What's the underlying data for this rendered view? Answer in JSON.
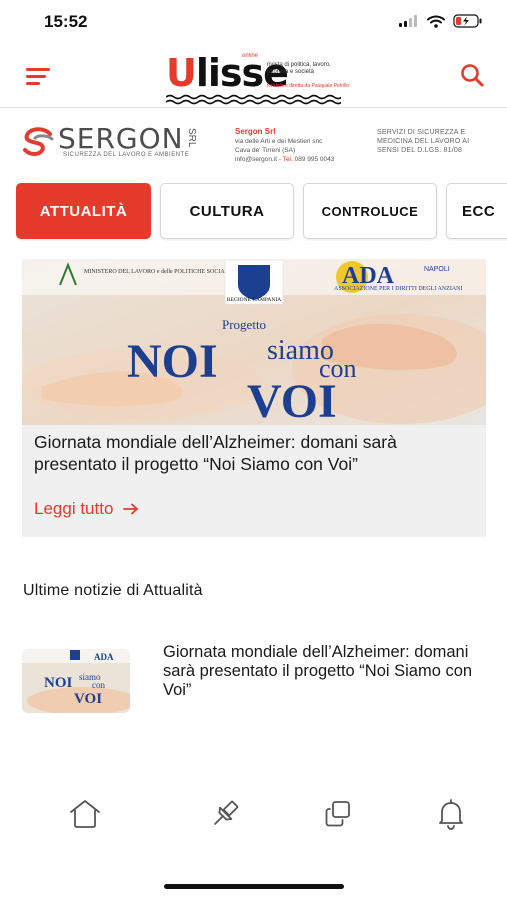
{
  "status_bar": {
    "time": "15:52"
  },
  "logo": {
    "word_first": "U",
    "word_rest": "lisse",
    "online": "online",
    "tagline": "rivista di politica, lavoro, impresa e società",
    "founder": "fondata e diretta da Pasquale Petrillo"
  },
  "sponsor": {
    "name": "SERGON",
    "srl": "SRL",
    "subtitle": "SICUREZZA DEL LAVORO E AMBIENTE",
    "company": "Sergon Srl",
    "address_line1": "via delle Arti e dei Mestieri snc",
    "address_line2": "Cava de' Tirreni (SA)",
    "email": "info@sergon.it",
    "tel_label": "Tel.",
    "tel": "089 995 0043",
    "services": "SERVIZI DI SICUREZZA E MEDICINA DEL LAVORO AI SENSI DEL D.LGS. 81/08"
  },
  "tabs": [
    {
      "label": "ATTUALITÀ",
      "active": true
    },
    {
      "label": "CULTURA",
      "active": false
    },
    {
      "label": "CONTROLUCE",
      "active": false
    },
    {
      "label": "ECC",
      "active": false
    }
  ],
  "featured": {
    "image": {
      "ministry": "MINISTERO DEL LAVORO e delle POLITICHE SOCIALI",
      "region": "REGIONE CAMPANIA",
      "ada": "ADA",
      "ada_city": "NAPOLI",
      "ada_sub": "ASSOCIAZIONE PER I DIRITTI DEGLI ANZIANI",
      "progetto": "Progetto",
      "noi": "NOI",
      "siamo": "siamo",
      "con": "con",
      "voi": "VOI"
    },
    "title": "Giornata mondiale dell’Alzheimer: domani sarà presentato il progetto “Noi Siamo con Voi”",
    "read_more": "Leggi tutto"
  },
  "section_title": "Ultime notizie di Attualità",
  "news": [
    {
      "title": "Giornata mondiale dell’Alzheimer: domani sarà presentato il progetto “Noi Siamo con Voi”",
      "thumb": {
        "noi": "NOI",
        "siamo": "siamo",
        "con": "con",
        "voi": "VOI",
        "ada": "ADA"
      }
    }
  ],
  "colors": {
    "accent": "#e53a2c",
    "text": "#1a1a1a",
    "card_bg": "#f0f0f0",
    "project_blue": "#1d3f8f"
  },
  "nav_icons": [
    "home-icon",
    "pin-icon",
    "copy-icon",
    "bell-icon"
  ]
}
